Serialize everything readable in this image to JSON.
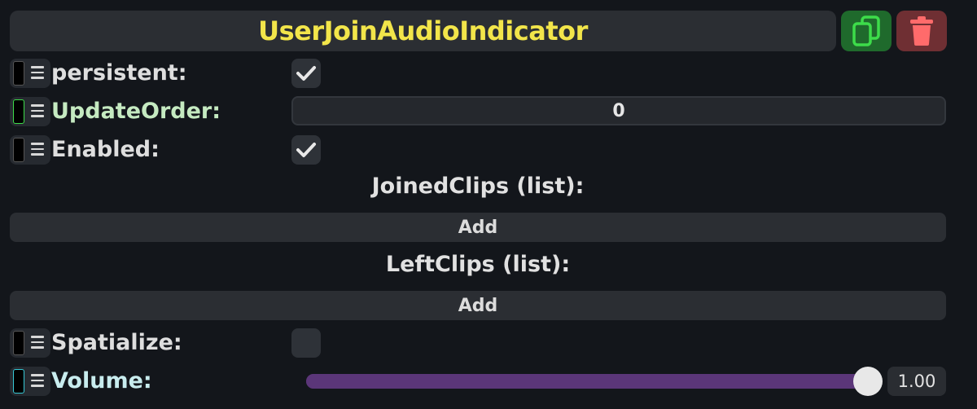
{
  "component": {
    "title": "UserJoinAudioIndicator",
    "title_color": "#f2e54a",
    "duplicate_icon": "duplicate-icon",
    "delete_icon": "trash-icon"
  },
  "fields": {
    "persistent": {
      "label": "persistent:",
      "checked": true
    },
    "update_order": {
      "label": "UpdateOrder:",
      "value": "0"
    },
    "enabled": {
      "label": "Enabled:",
      "checked": true
    },
    "spatialize": {
      "label": "Spatialize:",
      "checked": false
    },
    "volume": {
      "label": "Volume:",
      "value": "1.00",
      "level": 1.0
    }
  },
  "lists": {
    "joined_clips": {
      "title": "JoinedClips (list):",
      "add_label": "Add"
    },
    "left_clips": {
      "title": "LeftClips (list):",
      "add_label": "Add"
    }
  },
  "colors": {
    "accent_green": "#3ddc4a",
    "accent_cyan": "#36c9d6",
    "slider": "#5b3679",
    "delete": "#ff6b6b"
  }
}
